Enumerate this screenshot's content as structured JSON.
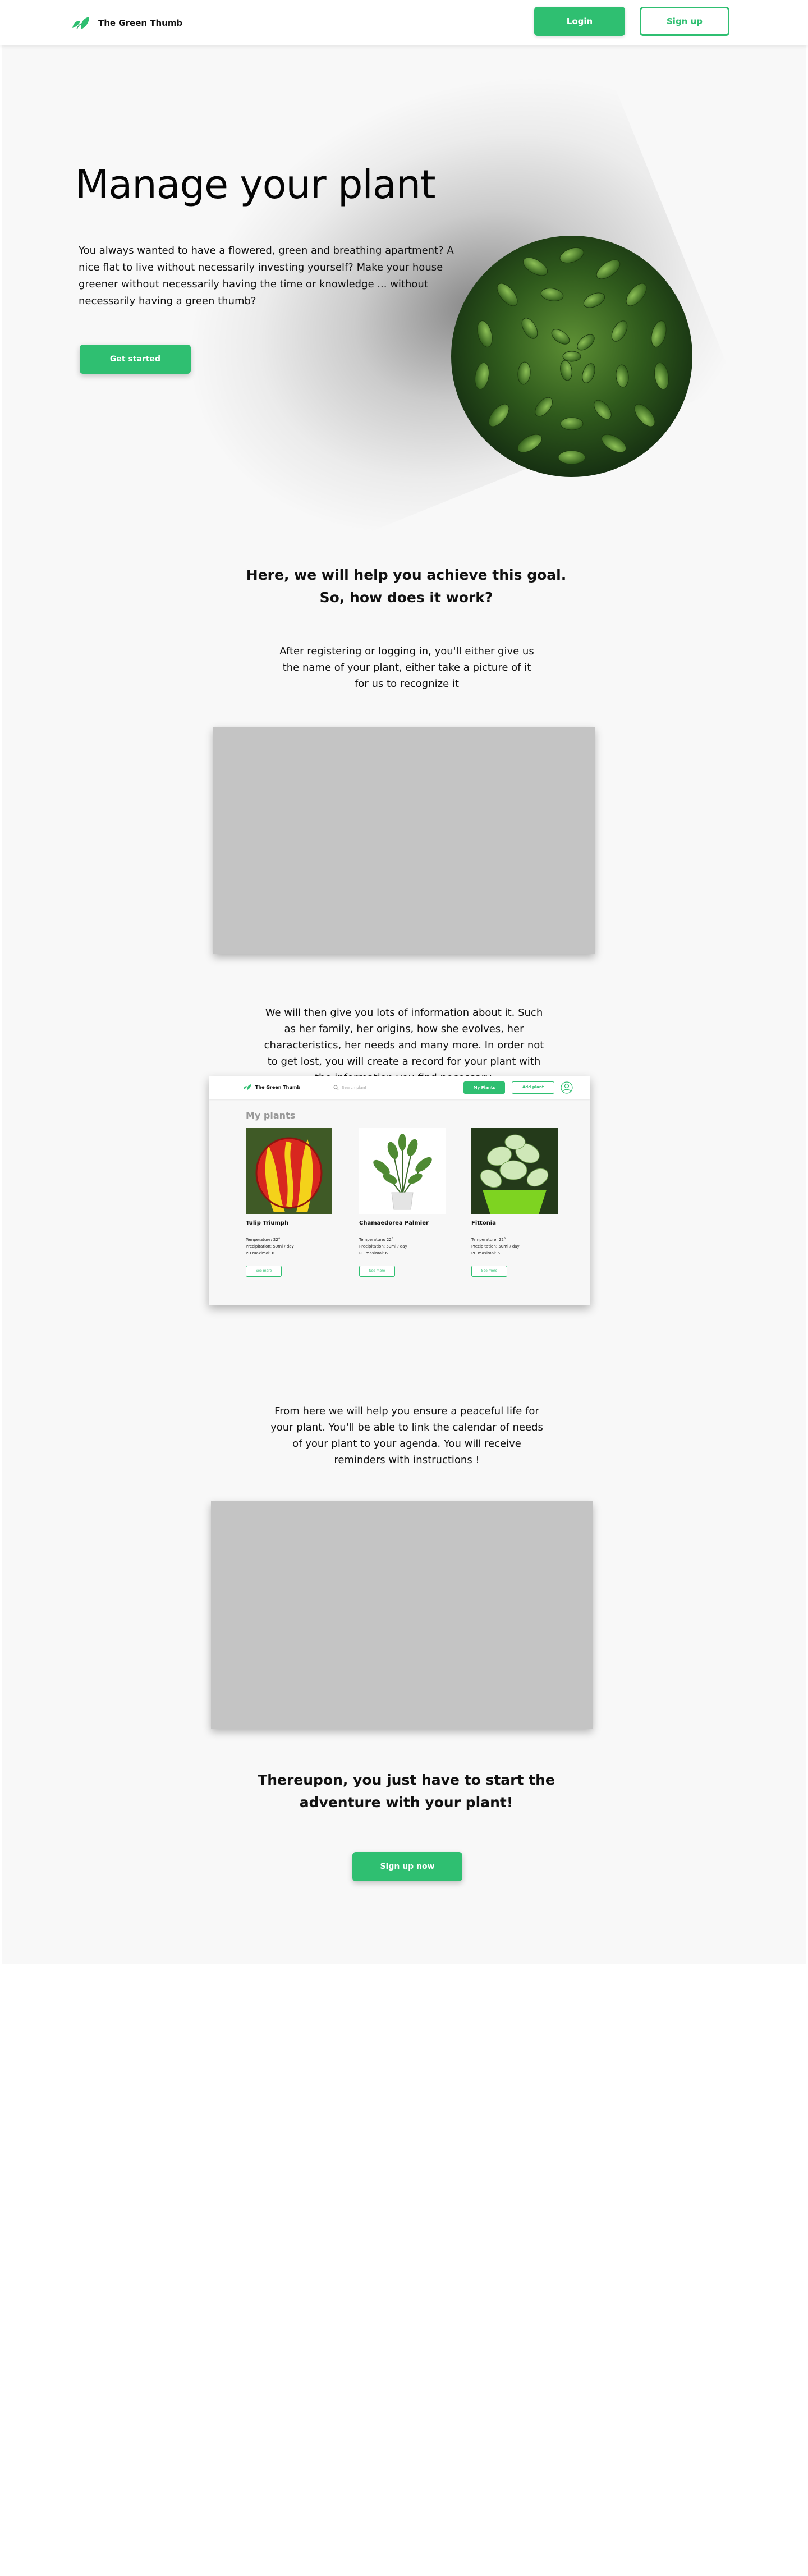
{
  "header": {
    "logo_text": "The Green Thumb",
    "login_label": "Login",
    "signup_label": "Sign up"
  },
  "hero": {
    "title": "Manage your plant",
    "text": "You always wanted to have a flowered, green and breathing apartment? A nice flat to live without necessarily investing yourself? Make your house greener without necessarily having the time or knowledge ... without necessarily having a green thumb?",
    "cta_label": "Get started"
  },
  "how": {
    "title_line1": "Here, we will help you achieve this goal.",
    "title_line2": "So, how does it work?",
    "step1": "After registering or logging in, you'll either give us the name of your plant, either take a picture of it for us to recognize it",
    "step2": "We will then give you lots of information about it. Such as her family, her origins, how she evolves, her characteristics, her needs and many more. In order not to get lost, you will create a record for your plant with the information you find necessary.",
    "step3": "From here we will help you ensure a peaceful life for your plant. You'll be able to link the calendar of needs of your plant to your agenda. You will receive reminders with instructions !"
  },
  "app_preview": {
    "logo_text": "The Green Thumb",
    "search_placeholder": "Search plant",
    "btn_primary": "My Plants",
    "btn_secondary": "Add plant",
    "section_title": "My plants",
    "plants": [
      {
        "name": "Tulip Triumph",
        "temperature": "Temperature: 22°",
        "precipitation": "Precipitation: 50ml / day",
        "ph": "PH maximal: 6",
        "button": "See more"
      },
      {
        "name": "Chamaedorea Palmier",
        "temperature": "Temperature: 22°",
        "precipitation": "Precipitation: 50ml / day",
        "ph": "PH maximal: 6",
        "button": "See more"
      },
      {
        "name": "Fittonia",
        "temperature": "Temperature: 22°",
        "precipitation": "Precipitation: 50ml / day",
        "ph": "PH maximal: 6",
        "button": "See more"
      }
    ]
  },
  "final": {
    "title_line1": "Thereupon, you just have to start the",
    "title_line2": "adventure with your plant!",
    "cta_label": "Sign up now"
  },
  "colors": {
    "accent": "#2fbf71",
    "section_bg": "#f8f8f8",
    "placeholder": "#c4c4c4"
  },
  "icons": [
    "leaf-logo-icon",
    "search-icon",
    "avatar-icon"
  ]
}
